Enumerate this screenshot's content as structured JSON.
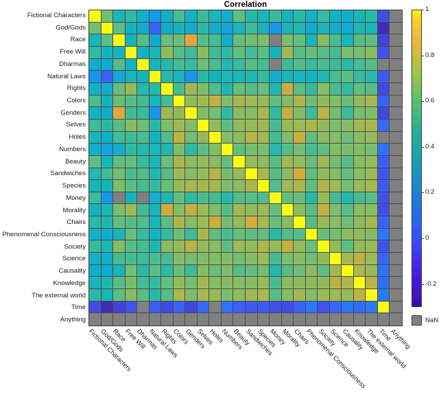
{
  "chart_data": {
    "type": "heatmap",
    "title": "Correlation",
    "xlabel": "",
    "ylabel": "",
    "grid": true,
    "legend_position": "right",
    "colormap": "parula",
    "clim": [
      -0.3,
      1
    ],
    "colorbar_ticks": [
      1,
      0.8,
      0.6,
      0.4,
      0.2,
      0,
      -0.2
    ],
    "nan_label": "NaN",
    "nan_color": "#808080",
    "categories": [
      "Fictional Characters",
      "God/Gods",
      "Race",
      "Free Will",
      "Dharmas",
      "Natural Laws",
      "Rights",
      "Colors",
      "Genders",
      "Selves",
      "Holes",
      "Numbers",
      "Beauty",
      "Sandwiches",
      "Species",
      "Money",
      "Morality",
      "Chairs",
      "Phenomenal Consciousness",
      "Society",
      "Science",
      "Causality",
      "Knowledge",
      "The external world",
      "Time",
      "Anything"
    ],
    "x_categories": [
      "Fictional Characters",
      "God/Gods",
      "Race",
      "Free Will",
      "Dharmas",
      "Natural Laws",
      "Rights",
      "Colors",
      "Genders",
      "Selves",
      "Holes",
      "Numbers",
      "Beauty",
      "Sandwiches",
      "Species",
      "Money",
      "Morality",
      "Chairs",
      "Phenomenal Consciousness",
      "Society",
      "Science",
      "Causality",
      "Knowledge",
      "The external world",
      "Time",
      "Anything"
    ],
    "y_categories": [
      "Fictional Characters",
      "God/Gods",
      "Race",
      "Free Will",
      "Dharmas",
      "Natural Laws",
      "Rights",
      "Colors",
      "Genders",
      "Selves",
      "Holes",
      "Numbers",
      "Beauty",
      "Sandwiches",
      "Species",
      "Money",
      "Morality",
      "Chairs",
      "Phenomenal Consciousness",
      "Society",
      "Science",
      "Causality",
      "Knowledge",
      "The external world",
      "Time",
      "Anything"
    ],
    "values": [
      [
        1.0,
        0.38,
        0.22,
        0.27,
        0.18,
        0.05,
        0.19,
        0.31,
        0.2,
        0.29,
        0.22,
        0.18,
        0.34,
        0.25,
        0.22,
        0.28,
        0.21,
        0.26,
        0.19,
        0.28,
        0.19,
        0.17,
        0.22,
        0.26,
        -0.18,
        null
      ],
      [
        0.38,
        1.0,
        0.34,
        0.2,
        0.16,
        -0.12,
        0.17,
        0.21,
        0.17,
        0.26,
        0.18,
        0.13,
        0.22,
        0.29,
        0.21,
        0.05,
        0.23,
        0.24,
        0.16,
        0.23,
        0.18,
        0.15,
        0.24,
        0.22,
        -0.28,
        null
      ],
      [
        0.22,
        0.34,
        1.0,
        0.21,
        0.33,
        0.14,
        0.36,
        0.37,
        0.62,
        0.33,
        0.3,
        0.18,
        0.35,
        0.38,
        0.4,
        null,
        0.39,
        0.35,
        0.22,
        0.42,
        0.31,
        0.22,
        0.33,
        0.34,
        -0.21,
        null
      ],
      [
        0.27,
        0.2,
        0.21,
        1.0,
        0.19,
        0.22,
        0.44,
        0.33,
        0.29,
        0.42,
        0.29,
        0.27,
        0.35,
        0.3,
        0.34,
        0.21,
        0.47,
        0.33,
        0.36,
        0.33,
        0.3,
        0.39,
        0.39,
        0.42,
        -0.16,
        null
      ],
      [
        0.18,
        0.16,
        0.33,
        0.19,
        1.0,
        0.21,
        0.25,
        0.3,
        0.28,
        0.37,
        0.31,
        0.25,
        0.28,
        0.33,
        0.3,
        null,
        0.29,
        0.32,
        0.28,
        0.31,
        0.29,
        0.26,
        0.3,
        0.33,
        null,
        null
      ],
      [
        0.05,
        -0.12,
        0.14,
        0.22,
        0.21,
        1.0,
        0.25,
        0.22,
        0.05,
        0.26,
        0.2,
        0.23,
        0.22,
        0.24,
        0.28,
        0.18,
        0.22,
        0.22,
        0.2,
        0.24,
        0.31,
        0.34,
        0.28,
        0.26,
        -0.14,
        null
      ],
      [
        0.19,
        0.17,
        0.36,
        0.44,
        0.25,
        0.25,
        1.0,
        0.3,
        0.46,
        0.4,
        0.32,
        0.24,
        0.36,
        0.33,
        0.36,
        0.24,
        0.57,
        0.34,
        0.28,
        0.42,
        0.31,
        0.27,
        0.35,
        0.33,
        -0.19,
        null
      ],
      [
        0.31,
        0.21,
        0.37,
        0.33,
        0.3,
        0.22,
        0.3,
        1.0,
        0.44,
        0.47,
        0.53,
        0.4,
        0.48,
        0.46,
        0.45,
        0.35,
        0.41,
        0.5,
        0.37,
        0.44,
        0.41,
        0.36,
        0.44,
        0.48,
        -0.12,
        null
      ],
      [
        0.2,
        0.17,
        0.62,
        0.29,
        0.28,
        0.05,
        0.46,
        0.44,
        1.0,
        0.41,
        0.38,
        0.27,
        0.43,
        0.42,
        0.48,
        0.27,
        0.55,
        0.41,
        0.29,
        0.52,
        0.38,
        0.29,
        0.39,
        0.4,
        -0.2,
        null
      ],
      [
        0.29,
        0.26,
        0.33,
        0.42,
        0.37,
        0.26,
        0.4,
        0.47,
        0.41,
        1.0,
        0.44,
        0.34,
        0.44,
        0.45,
        0.47,
        0.31,
        0.46,
        0.46,
        0.49,
        0.44,
        0.4,
        0.42,
        0.47,
        0.48,
        -0.1,
        null
      ],
      [
        0.22,
        0.18,
        0.3,
        0.29,
        0.31,
        0.2,
        0.32,
        0.53,
        0.38,
        0.44,
        1.0,
        0.41,
        0.43,
        0.52,
        0.47,
        0.3,
        0.4,
        0.56,
        0.35,
        0.42,
        0.41,
        0.37,
        0.42,
        0.45,
        null,
        null
      ],
      [
        0.18,
        0.13,
        0.18,
        0.27,
        0.25,
        0.23,
        0.24,
        0.4,
        0.27,
        0.34,
        0.41,
        1.0,
        0.35,
        0.38,
        0.4,
        0.25,
        0.33,
        0.38,
        0.31,
        0.34,
        0.41,
        0.4,
        0.41,
        0.39,
        -0.08,
        null
      ],
      [
        0.34,
        0.22,
        0.35,
        0.35,
        0.28,
        0.22,
        0.36,
        0.48,
        0.43,
        0.44,
        0.43,
        0.35,
        1.0,
        0.44,
        0.43,
        0.33,
        0.47,
        0.44,
        0.36,
        0.46,
        0.38,
        0.33,
        0.42,
        0.44,
        -0.13,
        null
      ],
      [
        0.25,
        0.29,
        0.38,
        0.3,
        0.33,
        0.24,
        0.33,
        0.46,
        0.42,
        0.45,
        0.52,
        0.38,
        0.44,
        1.0,
        0.49,
        0.33,
        0.43,
        0.58,
        0.34,
        0.44,
        0.41,
        0.35,
        0.42,
        0.46,
        -0.15,
        null
      ],
      [
        0.22,
        0.21,
        0.4,
        0.34,
        0.3,
        0.28,
        0.36,
        0.45,
        0.48,
        0.47,
        0.47,
        0.4,
        0.43,
        0.49,
        1.0,
        0.32,
        0.46,
        0.48,
        0.35,
        0.5,
        0.46,
        0.38,
        0.45,
        0.48,
        -0.14,
        null
      ],
      [
        0.28,
        0.05,
        null,
        0.21,
        null,
        0.18,
        0.24,
        0.35,
        0.27,
        0.31,
        0.3,
        0.25,
        0.33,
        0.33,
        0.32,
        1.0,
        0.36,
        0.36,
        0.26,
        0.44,
        0.3,
        0.25,
        0.31,
        0.33,
        -0.17,
        null
      ],
      [
        0.21,
        0.23,
        0.39,
        0.47,
        0.29,
        0.22,
        0.57,
        0.41,
        0.55,
        0.46,
        0.4,
        0.33,
        0.47,
        0.43,
        0.46,
        0.36,
        1.0,
        0.43,
        0.33,
        0.55,
        0.4,
        0.33,
        0.43,
        0.42,
        -0.18,
        null
      ],
      [
        0.26,
        0.24,
        0.35,
        0.33,
        0.32,
        0.22,
        0.34,
        0.5,
        0.41,
        0.46,
        0.56,
        0.38,
        0.44,
        0.58,
        0.48,
        0.36,
        0.43,
        1.0,
        0.33,
        0.45,
        0.42,
        0.37,
        0.43,
        0.47,
        -0.12,
        null
      ],
      [
        0.19,
        0.16,
        0.22,
        0.36,
        0.28,
        0.2,
        0.28,
        0.37,
        0.29,
        0.49,
        0.35,
        0.31,
        0.36,
        0.34,
        0.35,
        0.26,
        0.33,
        0.33,
        1.0,
        0.36,
        0.38,
        0.43,
        0.44,
        0.41,
        -0.06,
        null
      ],
      [
        0.28,
        0.23,
        0.42,
        0.33,
        0.31,
        0.24,
        0.42,
        0.44,
        0.52,
        0.44,
        0.42,
        0.34,
        0.46,
        0.44,
        0.5,
        0.44,
        0.55,
        0.45,
        0.36,
        1.0,
        0.44,
        0.34,
        0.44,
        0.45,
        -0.16,
        null
      ],
      [
        0.19,
        0.18,
        0.31,
        0.3,
        0.29,
        0.31,
        0.31,
        0.41,
        0.38,
        0.4,
        0.41,
        0.41,
        0.38,
        0.41,
        0.46,
        0.3,
        0.4,
        0.42,
        0.38,
        0.44,
        1.0,
        0.47,
        0.52,
        0.46,
        -0.11,
        null
      ],
      [
        0.17,
        0.15,
        0.22,
        0.39,
        0.26,
        0.34,
        0.27,
        0.36,
        0.29,
        0.42,
        0.37,
        0.4,
        0.33,
        0.35,
        0.38,
        0.25,
        0.33,
        0.37,
        0.43,
        0.34,
        0.47,
        1.0,
        0.5,
        0.45,
        -0.07,
        null
      ],
      [
        0.22,
        0.24,
        0.33,
        0.39,
        0.3,
        0.28,
        0.35,
        0.44,
        0.39,
        0.47,
        0.42,
        0.41,
        0.42,
        0.42,
        0.45,
        0.31,
        0.43,
        0.43,
        0.44,
        0.44,
        0.52,
        0.5,
        1.0,
        0.52,
        -0.09,
        null
      ],
      [
        0.26,
        0.22,
        0.34,
        0.42,
        0.33,
        0.26,
        0.33,
        0.48,
        0.4,
        0.48,
        0.45,
        0.39,
        0.44,
        0.46,
        0.48,
        0.33,
        0.42,
        0.47,
        0.41,
        0.45,
        0.46,
        0.45,
        0.52,
        1.0,
        -0.05,
        null
      ],
      [
        -0.18,
        -0.28,
        -0.21,
        -0.16,
        null,
        -0.14,
        -0.19,
        -0.12,
        -0.2,
        -0.1,
        null,
        -0.08,
        -0.13,
        -0.15,
        -0.14,
        -0.17,
        -0.18,
        -0.12,
        -0.06,
        -0.16,
        -0.11,
        -0.07,
        -0.09,
        -0.05,
        1.0,
        null
      ],
      [
        null,
        null,
        null,
        null,
        null,
        null,
        null,
        null,
        null,
        null,
        null,
        null,
        null,
        null,
        null,
        null,
        null,
        null,
        null,
        null,
        null,
        null,
        null,
        null,
        null,
        null
      ]
    ]
  }
}
